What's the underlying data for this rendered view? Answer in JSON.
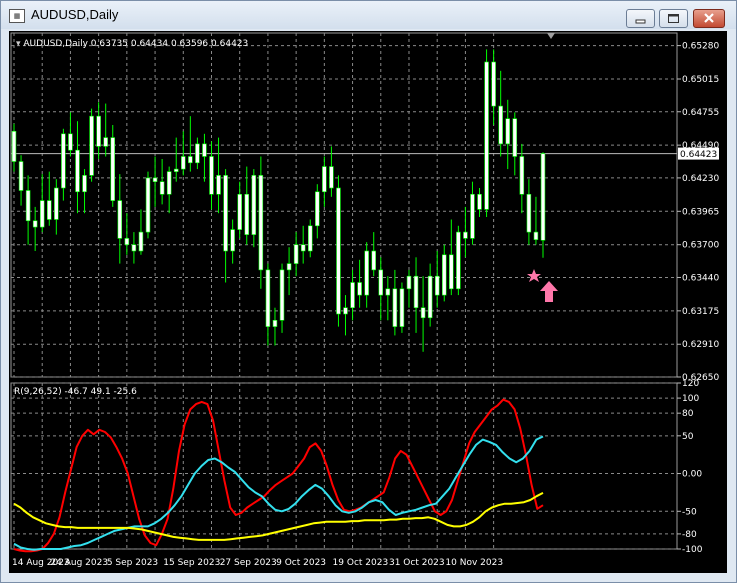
{
  "window": {
    "title": "AUDUSD,Daily",
    "buttons": {
      "minimize": "minimize-icon",
      "maximize": "maximize-icon",
      "close": "close-icon"
    }
  },
  "chart": {
    "info_label": "AUDUSD,Daily  0.63735 0.64434 0.63596 0.64423",
    "current_price_tag": "0.64423",
    "indicator_label": "R(9,26,52) -46.7 49.1 -25.6",
    "colors": {
      "background": "#000000",
      "grid": "#8a8a8a",
      "bull": "#ffffff",
      "bear": "#00ff00",
      "red": "#ff0000",
      "cyan": "#33e0ee",
      "yellow": "#ffff00",
      "marker": "#ff77aa"
    },
    "marker_icons": [
      "star-icon",
      "arrow-up-icon"
    ]
  },
  "chart_data": [
    {
      "type": "candlestick",
      "title": "AUDUSD,Daily",
      "ylim": [
        0.6265,
        0.6538
      ],
      "y_ticks": [
        "0.65280",
        "0.65015",
        "0.64755",
        "0.64490",
        "0.64230",
        "0.63965",
        "0.63700",
        "0.63440",
        "0.63175",
        "0.62910",
        "0.62650"
      ],
      "x_ticks": [
        "14 Aug 2023",
        "24 Aug 2023",
        "5 Sep 2023",
        "15 Sep 2023",
        "27 Sep 2023",
        "9 Oct 2023",
        "19 Oct 2023",
        "31 Oct 2023",
        "10 Nov 2023"
      ],
      "ohlc": [
        [
          0.646,
          0.6466,
          0.6428,
          0.6436
        ],
        [
          0.6436,
          0.6441,
          0.6401,
          0.6413
        ],
        [
          0.6413,
          0.6425,
          0.637,
          0.6389
        ],
        [
          0.6389,
          0.64,
          0.6365,
          0.6384
        ],
        [
          0.6384,
          0.6426,
          0.638,
          0.6405
        ],
        [
          0.6405,
          0.6428,
          0.6385,
          0.639
        ],
        [
          0.639,
          0.6422,
          0.6378,
          0.6415
        ],
        [
          0.6415,
          0.6462,
          0.6405,
          0.6458
        ],
        [
          0.6458,
          0.6475,
          0.644,
          0.6445
        ],
        [
          0.6445,
          0.6468,
          0.6395,
          0.6412
        ],
        [
          0.6412,
          0.643,
          0.6395,
          0.6425
        ],
        [
          0.6425,
          0.6478,
          0.642,
          0.6472
        ],
        [
          0.6472,
          0.6483,
          0.6438,
          0.6448
        ],
        [
          0.6448,
          0.6482,
          0.644,
          0.6455
        ],
        [
          0.6455,
          0.6465,
          0.64,
          0.6405
        ],
        [
          0.6405,
          0.6426,
          0.6355,
          0.6375
        ],
        [
          0.6375,
          0.6395,
          0.6362,
          0.637
        ],
        [
          0.637,
          0.638,
          0.6355,
          0.6365
        ],
        [
          0.6365,
          0.6398,
          0.6362,
          0.638
        ],
        [
          0.638,
          0.6428,
          0.6375,
          0.6423
        ],
        [
          0.6423,
          0.644,
          0.64,
          0.642
        ],
        [
          0.642,
          0.6438,
          0.6402,
          0.641
        ],
        [
          0.641,
          0.6432,
          0.6395,
          0.6428
        ],
        [
          0.6428,
          0.6455,
          0.642,
          0.643
        ],
        [
          0.643,
          0.646,
          0.6425,
          0.644
        ],
        [
          0.644,
          0.6472,
          0.6428,
          0.6435
        ],
        [
          0.6435,
          0.6455,
          0.643,
          0.645
        ],
        [
          0.645,
          0.6458,
          0.642,
          0.644
        ],
        [
          0.644,
          0.6452,
          0.6398,
          0.641
        ],
        [
          0.641,
          0.6455,
          0.6395,
          0.6425
        ],
        [
          0.6425,
          0.643,
          0.634,
          0.6365
        ],
        [
          0.6365,
          0.639,
          0.6355,
          0.6382
        ],
        [
          0.6382,
          0.642,
          0.6375,
          0.641
        ],
        [
          0.641,
          0.6432,
          0.637,
          0.6378
        ],
        [
          0.6378,
          0.643,
          0.6368,
          0.6425
        ],
        [
          0.6425,
          0.644,
          0.6335,
          0.635
        ],
        [
          0.635,
          0.6355,
          0.629,
          0.6305
        ],
        [
          0.6305,
          0.632,
          0.629,
          0.631
        ],
        [
          0.631,
          0.6355,
          0.63,
          0.635
        ],
        [
          0.635,
          0.6368,
          0.633,
          0.6355
        ],
        [
          0.6355,
          0.638,
          0.6345,
          0.637
        ],
        [
          0.637,
          0.6385,
          0.6355,
          0.6365
        ],
        [
          0.6365,
          0.639,
          0.636,
          0.6385
        ],
        [
          0.6385,
          0.6418,
          0.6375,
          0.6412
        ],
        [
          0.6412,
          0.644,
          0.64,
          0.6432
        ],
        [
          0.6432,
          0.6448,
          0.6408,
          0.6415
        ],
        [
          0.6415,
          0.6425,
          0.6305,
          0.6315
        ],
        [
          0.6315,
          0.633,
          0.6298,
          0.632
        ],
        [
          0.632,
          0.635,
          0.631,
          0.634
        ],
        [
          0.634,
          0.6358,
          0.632,
          0.633
        ],
        [
          0.633,
          0.6372,
          0.632,
          0.6365
        ],
        [
          0.6365,
          0.638,
          0.6345,
          0.635
        ],
        [
          0.635,
          0.636,
          0.631,
          0.633
        ],
        [
          0.633,
          0.6345,
          0.631,
          0.6335
        ],
        [
          0.6335,
          0.635,
          0.6298,
          0.6305
        ],
        [
          0.6305,
          0.634,
          0.63,
          0.6335
        ],
        [
          0.6335,
          0.635,
          0.632,
          0.6345
        ],
        [
          0.6345,
          0.636,
          0.63,
          0.632
        ],
        [
          0.632,
          0.6345,
          0.6285,
          0.6312
        ],
        [
          0.6312,
          0.6355,
          0.6305,
          0.6345
        ],
        [
          0.6345,
          0.6365,
          0.632,
          0.633
        ],
        [
          0.633,
          0.637,
          0.6325,
          0.6362
        ],
        [
          0.6362,
          0.639,
          0.633,
          0.6335
        ],
        [
          0.6335,
          0.6385,
          0.633,
          0.638
        ],
        [
          0.638,
          0.64,
          0.636,
          0.6375
        ],
        [
          0.6375,
          0.642,
          0.637,
          0.641
        ],
        [
          0.641,
          0.6415,
          0.6392,
          0.6398
        ],
        [
          0.6398,
          0.6525,
          0.6392,
          0.6515
        ],
        [
          0.6515,
          0.6525,
          0.6465,
          0.648
        ],
        [
          0.648,
          0.6508,
          0.644,
          0.645
        ],
        [
          0.645,
          0.6485,
          0.643,
          0.647
        ],
        [
          0.647,
          0.6475,
          0.6425,
          0.644
        ],
        [
          0.644,
          0.645,
          0.6395,
          0.641
        ],
        [
          0.641,
          0.6422,
          0.637,
          0.638
        ],
        [
          0.638,
          0.6408,
          0.637,
          0.6374
        ],
        [
          0.63735,
          0.64434,
          0.63596,
          0.64423
        ]
      ]
    },
    {
      "type": "line",
      "title": "R(9,26,52) -46.7 49.1 -25.6",
      "ylim": [
        -100,
        120
      ],
      "y_ticks": [
        "120",
        "100",
        "80",
        "50",
        "0.00",
        "-50",
        "-80",
        "-100"
      ],
      "series": [
        {
          "name": "R(9)",
          "values": [
            -100,
            -102,
            -103,
            -103,
            -102,
            -100,
            -92,
            -80,
            -58,
            -25,
            5,
            35,
            50,
            58,
            52,
            58,
            55,
            48,
            35,
            20,
            0,
            -30,
            -60,
            -82,
            -92,
            -95,
            -80,
            -60,
            -20,
            30,
            65,
            85,
            92,
            95,
            92,
            70,
            30,
            -10,
            -45,
            -55,
            -52,
            -45,
            -40,
            -35,
            -30,
            -22,
            -15,
            -10,
            -5,
            0,
            10,
            20,
            35,
            40,
            30,
            10,
            -15,
            -35,
            -48,
            -50,
            -48,
            -45,
            -40,
            -35,
            -30,
            -25,
            -5,
            20,
            30,
            25,
            10,
            -5,
            -20,
            -35,
            -50,
            -55,
            -50,
            -35,
            -10,
            15,
            40,
            55,
            65,
            75,
            85,
            90,
            98,
            95,
            85,
            60,
            25,
            -15,
            -46.7,
            -42
          ]
        },
        {
          "name": "R(26)",
          "values": [
            -93,
            -98,
            -100,
            -101,
            -100,
            -100,
            -100,
            -100,
            -98,
            -96,
            -95,
            -92,
            -88,
            -84,
            -80,
            -76,
            -74,
            -72,
            -70,
            -70,
            -70,
            -66,
            -60,
            -52,
            -42,
            -30,
            -15,
            0,
            10,
            18,
            20,
            15,
            8,
            2,
            -8,
            -18,
            -25,
            -30,
            -40,
            -48,
            -50,
            -47,
            -40,
            -30,
            -22,
            -15,
            -20,
            -30,
            -42,
            -50,
            -52,
            -50,
            -45,
            -38,
            -35,
            -38,
            -48,
            -55,
            -52,
            -50,
            -48,
            -45,
            -42,
            -40,
            -30,
            -20,
            -5,
            10,
            25,
            38,
            45,
            42,
            38,
            28,
            20,
            15,
            20,
            30,
            45,
            49.1
          ]
        },
        {
          "name": "R(52)",
          "values": [
            -40,
            -45,
            -52,
            -58,
            -62,
            -66,
            -68,
            -70,
            -71,
            -71,
            -72,
            -72,
            -72,
            -72,
            -72,
            -72,
            -72,
            -72,
            -72,
            -73,
            -74,
            -76,
            -78,
            -80,
            -82,
            -84,
            -85,
            -86,
            -87,
            -88,
            -88,
            -88,
            -88,
            -88,
            -87,
            -86,
            -85,
            -84,
            -83,
            -82,
            -80,
            -78,
            -76,
            -74,
            -72,
            -70,
            -68,
            -66,
            -65,
            -64,
            -64,
            -64,
            -64,
            -63,
            -63,
            -62,
            -62,
            -62,
            -62,
            -61,
            -61,
            -60,
            -60,
            -59,
            -59,
            -58,
            -60,
            -64,
            -68,
            -70,
            -70,
            -68,
            -64,
            -58,
            -50,
            -45,
            -42,
            -40,
            -40,
            -39,
            -38,
            -35,
            -30,
            -25.6
          ]
        }
      ]
    }
  ]
}
